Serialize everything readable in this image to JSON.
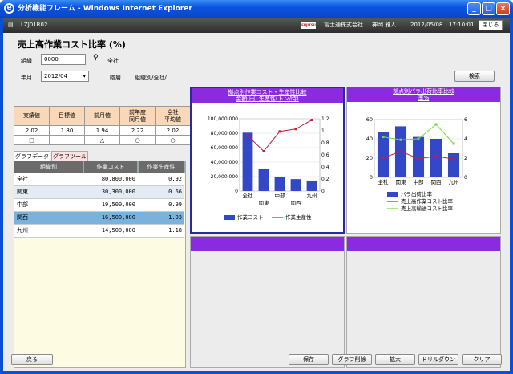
{
  "window": {
    "title": "分析機能フレーム - Windows Internet Explorer"
  },
  "appbar": {
    "screen_id": "LZJ01R02",
    "company": "富士通株式会社",
    "user": "神岡 雅人",
    "date": "2012/05/08",
    "time": "17:10:01",
    "close": "閉じる",
    "logo": "FUJITSU"
  },
  "page": {
    "title": "売上高作業コスト比率 (%)"
  },
  "form": {
    "org_label": "組織",
    "org_value": "0000",
    "org_name": "全社",
    "month_label": "年月",
    "month_value": "2012/04",
    "level_label": "階層",
    "level_value": "組織別/全社/",
    "search": "検索"
  },
  "kpi": {
    "headers": [
      "実績値",
      "目標値",
      "前月値",
      "前年度同月値",
      "全社平均値"
    ],
    "values": [
      "2.02",
      "1.80",
      "1.94",
      "2.22",
      "2.02"
    ],
    "marks": [
      "□",
      "",
      "△",
      "○",
      "○"
    ]
  },
  "tabs": [
    "グラフデータ",
    "グラフツール"
  ],
  "grid": {
    "headers": [
      "組織別",
      "作業コスト",
      "作業生産性"
    ],
    "rows": [
      [
        "全社",
        "80,800,000",
        "0.92"
      ],
      [
        "関東",
        "30,300,000",
        "0.66"
      ],
      [
        "中部",
        "19,500,000",
        "0.99"
      ],
      [
        "関西",
        "16,500,000",
        "1.03"
      ],
      [
        "九州",
        "14,500,000",
        "1.18"
      ]
    ]
  },
  "footer": {
    "back": "戻る",
    "save": "保存",
    "delete_graph": "グラフ削除",
    "zoom": "拡大",
    "drilldown": "ドリルダウン",
    "clear": "クリア"
  },
  "chart_data": [
    {
      "type": "bar",
      "title": "拠点別作業コスト・生産性比較",
      "subtitle": "金額(円) 生産性(トン/時)",
      "categories": [
        "全社",
        "関東",
        "中部",
        "関西",
        "九州"
      ],
      "series": [
        {
          "name": "作業コスト",
          "type": "bar",
          "values": [
            80800000,
            30300000,
            19500000,
            16500000,
            14500000
          ]
        },
        {
          "name": "作業生産性",
          "type": "line",
          "axis": "right",
          "values": [
            0.92,
            0.66,
            0.99,
            1.03,
            1.18
          ]
        }
      ],
      "ylim": [
        0,
        100000000
      ],
      "yticks": [
        "0",
        "20,000,000",
        "40,000,000",
        "60,000,000",
        "80,000,000",
        "100,000,000"
      ],
      "y2lim": [
        0,
        1.2
      ],
      "y2ticks": [
        "0",
        "0.2",
        "0.4",
        "0.6",
        "0.8",
        "1",
        "1.2"
      ],
      "colors": {
        "bar": "#3348c9",
        "line": "#c0203a"
      }
    },
    {
      "type": "bar",
      "title": "拠点別パラ出荷比率比較",
      "subtitle": "率%",
      "categories": [
        "全社",
        "関東",
        "中部",
        "関西",
        "九州"
      ],
      "series": [
        {
          "name": "バラ出荷比率",
          "type": "bar",
          "values": [
            47,
            53,
            42,
            40,
            25
          ]
        },
        {
          "name": "売上高作業コスト比率",
          "type": "line",
          "axis": "right",
          "values": [
            2.02,
            2.7,
            1.94,
            2.2,
            1.9
          ]
        },
        {
          "name": "売上高輸送コスト比率",
          "type": "line",
          "axis": "right",
          "values": [
            4.2,
            3.9,
            4.0,
            5.5,
            3.5
          ]
        }
      ],
      "ylim": [
        0,
        60
      ],
      "yticks": [
        "0",
        "20",
        "40",
        "60"
      ],
      "y2lim": [
        0,
        6
      ],
      "y2ticks": [
        "0",
        "2",
        "4",
        "6"
      ],
      "colors": {
        "bar": "#3348c9",
        "line1": "#c0203a",
        "line2": "#6fdc3a"
      }
    }
  ]
}
